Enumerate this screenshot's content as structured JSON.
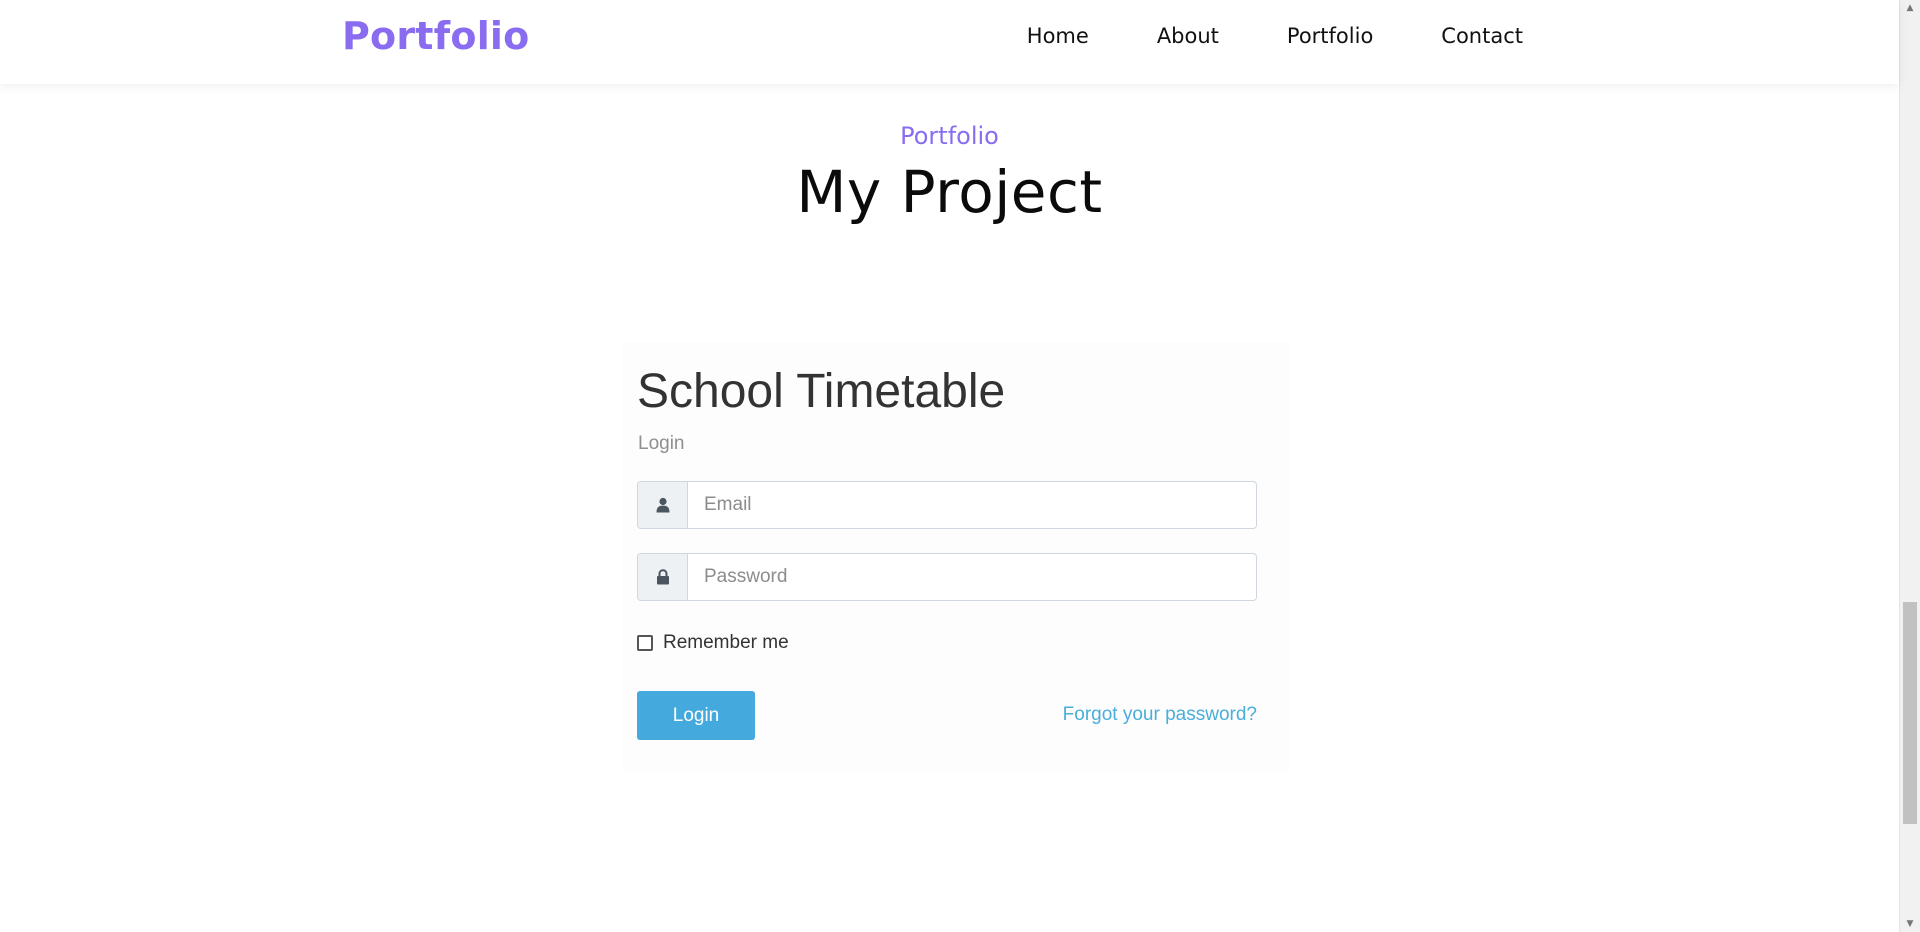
{
  "navbar": {
    "brand": "Portfolio",
    "links": [
      "Home",
      "About",
      "Portfolio",
      "Contact"
    ]
  },
  "section": {
    "eyebrow": "Portfolio",
    "title": "My Project"
  },
  "project_preview": {
    "title": "School Timetable",
    "subtitle": "Login",
    "email_placeholder": "Email",
    "password_placeholder": "Password",
    "remember_label": "Remember me",
    "login_button": "Login",
    "forgot_link": "Forgot your password?",
    "icons": {
      "email_addon": "user-icon",
      "password_addon": "lock-icon"
    }
  },
  "colors": {
    "accent": "#8a6cf0",
    "login_button": "#44a9dd",
    "link": "#4aaedb"
  }
}
